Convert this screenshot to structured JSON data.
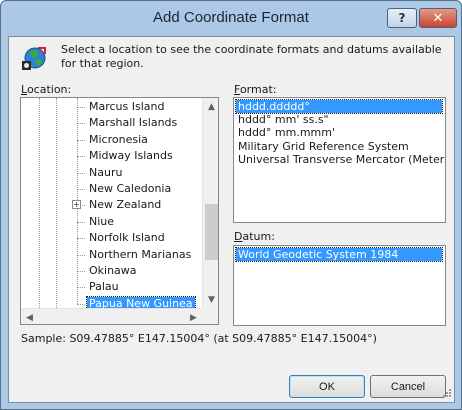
{
  "window": {
    "title": "Add Coordinate Format",
    "help_label": "?",
    "close_label": "✕"
  },
  "intro": "Select a location to see the coordinate formats and datums available for that region.",
  "location": {
    "label_prefix": "",
    "label_key": "L",
    "label_rest": "ocation:",
    "items": [
      {
        "label": "Marcus Island",
        "expandable": false,
        "selected": false
      },
      {
        "label": "Marshall Islands",
        "expandable": false,
        "selected": false
      },
      {
        "label": "Micronesia",
        "expandable": false,
        "selected": false
      },
      {
        "label": "Midway Islands",
        "expandable": false,
        "selected": false
      },
      {
        "label": "Nauru",
        "expandable": false,
        "selected": false
      },
      {
        "label": "New Caledonia",
        "expandable": false,
        "selected": false
      },
      {
        "label": "New Zealand",
        "expandable": true,
        "selected": false
      },
      {
        "label": "Niue",
        "expandable": false,
        "selected": false
      },
      {
        "label": "Norfolk Island",
        "expandable": false,
        "selected": false
      },
      {
        "label": "Northern Marianas",
        "expandable": false,
        "selected": false
      },
      {
        "label": "Okinawa",
        "expandable": false,
        "selected": false
      },
      {
        "label": "Palau",
        "expandable": false,
        "selected": false
      },
      {
        "label": "Papua New Guinea",
        "expandable": false,
        "selected": true
      }
    ]
  },
  "format": {
    "label_key": "F",
    "label_rest": "ormat:",
    "items": [
      {
        "label": "hddd.ddddd°",
        "selected": true
      },
      {
        "label": "hddd° mm' ss.s\"",
        "selected": false
      },
      {
        "label": "hddd° mm.mmm'",
        "selected": false
      },
      {
        "label": "Military Grid Reference System",
        "selected": false
      },
      {
        "label": "Universal Transverse Mercator (Meters)",
        "selected": false
      }
    ]
  },
  "datum": {
    "label_key": "D",
    "label_rest": "atum:",
    "items": [
      {
        "label": "World Geodetic System 1984",
        "selected": true
      }
    ]
  },
  "sample": "Sample: S09.47885° E147.15004° (at S09.47885° E147.15004°)",
  "buttons": {
    "ok": "OK",
    "cancel": "Cancel"
  },
  "colors": {
    "selection": "#3399ff",
    "frame": "#abc8e6",
    "close": "#c7452d"
  }
}
